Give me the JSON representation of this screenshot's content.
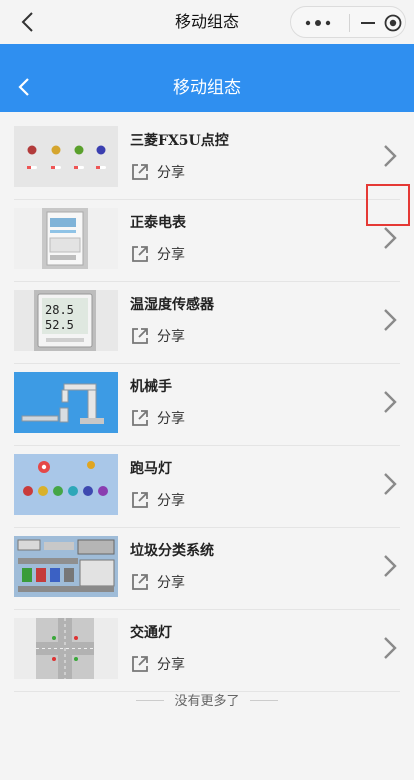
{
  "wechat": {
    "title": "移动组态"
  },
  "header": {
    "title": "移动组态"
  },
  "items": [
    {
      "name": "三菱FX5U点控",
      "share": "分享",
      "thumb": "lights-panel"
    },
    {
      "name": "正泰电表",
      "share": "分享",
      "thumb": "electric-meter"
    },
    {
      "name": "温湿度传感器",
      "share": "分享",
      "thumb": "temperature-humidity-display",
      "readings": [
        "28.5",
        "52.5"
      ]
    },
    {
      "name": "机械手",
      "share": "分享",
      "thumb": "robot-arm"
    },
    {
      "name": "跑马灯",
      "share": "分享",
      "thumb": "marquee-lights"
    },
    {
      "name": "垃圾分类系统",
      "share": "分享",
      "thumb": "sorting-system"
    },
    {
      "name": "交通灯",
      "share": "分享",
      "thumb": "traffic-lights"
    }
  ],
  "footer": "没有更多了",
  "colors": {
    "header_blue": "#2f8ff0",
    "highlight_red": "#e53935",
    "background": "#f4f4f4"
  }
}
